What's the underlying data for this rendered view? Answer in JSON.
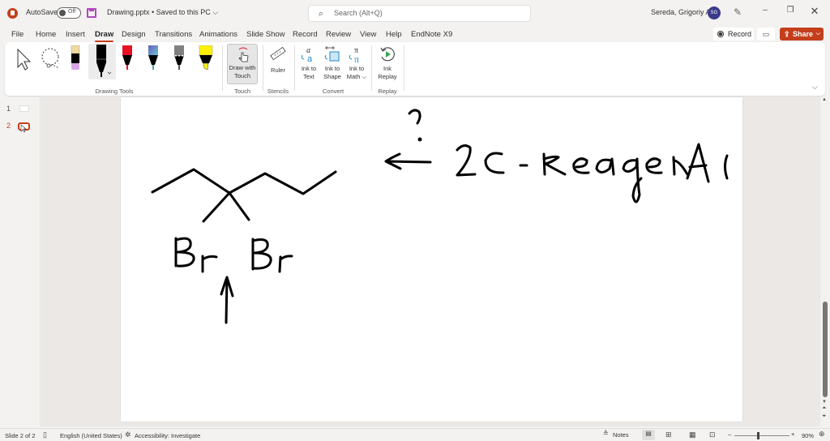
{
  "titlebar": {
    "autosave_label": "AutoSave",
    "autosave_state": "Off",
    "document_title": "Drawing.pptx • Saved to this PC ⌵",
    "search_placeholder": "Search (Alt+Q)",
    "user_name": "Sereda, Grigoriy A",
    "user_initials": "SG",
    "minimize": "–",
    "restore": "❐",
    "close": "✕"
  },
  "menu": {
    "items": [
      "File",
      "Home",
      "Insert",
      "Draw",
      "Design",
      "Transitions",
      "Animations",
      "Slide Show",
      "Record",
      "Review",
      "View",
      "Help",
      "EndNote X9"
    ],
    "active": "Draw",
    "record_label": "Record",
    "comments_icon": "💬",
    "share_label": "Share"
  },
  "ribbon": {
    "groups": {
      "drawing_tools": "Drawing Tools",
      "touch": "Touch",
      "stencils": "Stencils",
      "convert": "Convert",
      "replay": "Replay"
    },
    "buttons": {
      "draw_with_touch": "Draw with Touch",
      "ruler": "Ruler",
      "ink_to_text": "Ink to Text",
      "ink_to_shape": "Ink to Shape",
      "ink_to_math": "Ink to Math ⌵",
      "ink_replay": "Ink Replay"
    },
    "pens": [
      {
        "name": "eraser",
        "color": "#d9a6e6"
      },
      {
        "name": "black-pen",
        "color": "#000000"
      },
      {
        "name": "red-pen",
        "color": "#e81123"
      },
      {
        "name": "galaxy-pen",
        "color": "#4a9fb5"
      },
      {
        "name": "gray-pencil",
        "color": "#808080"
      },
      {
        "name": "yellow-highlighter",
        "color": "#fff100"
      }
    ]
  },
  "thumbnails": {
    "slides": [
      "1",
      "2"
    ],
    "active": "2"
  },
  "slide": {
    "ink_text": {
      "question_mark": "?",
      "reagents": "2c - reagents",
      "br_left": "Br",
      "br_right": "Br"
    },
    "ink_color": "#000000"
  },
  "statusbar": {
    "slide_count": "Slide 2 of 2",
    "language": "English (United States)",
    "accessibility": "Accessibility: Investigate",
    "notes_label": "Notes",
    "zoom_level": "90%",
    "zoom_minus": "–",
    "zoom_plus": "+"
  },
  "colors": {
    "accent": "#c43e1c",
    "avatar": "#3b3a8a"
  }
}
